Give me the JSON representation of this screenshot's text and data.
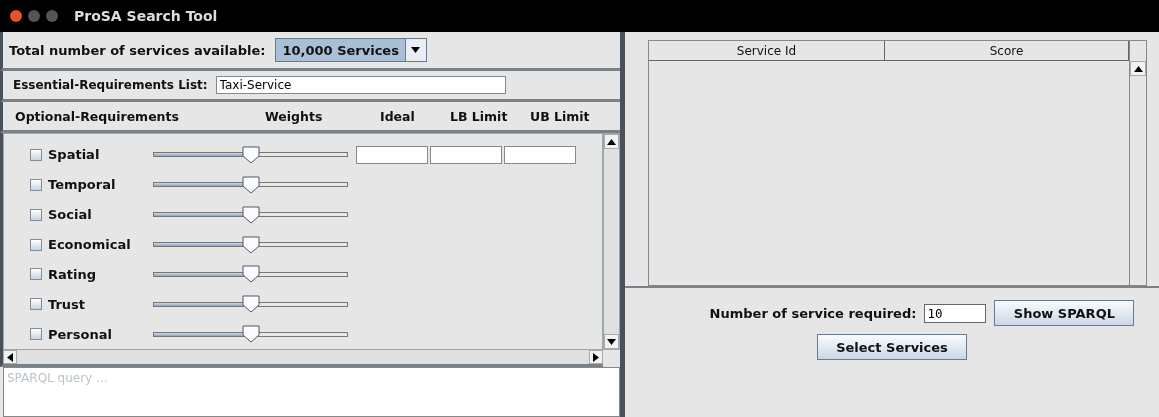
{
  "window": {
    "title": "ProSA Search Tool"
  },
  "services_available": {
    "label": "Total number of services available:",
    "value": "10,000 Services"
  },
  "essential": {
    "label": "Essential-Requirements List:",
    "value": "Taxi-Service"
  },
  "optional_header": {
    "columns": [
      "Optional-Requirements",
      "Weights",
      "Ideal",
      "LB Limit",
      "UB Limit"
    ]
  },
  "requirements": [
    {
      "name": "Spatial",
      "checked": false,
      "level": 0.5,
      "limit_fields": true
    },
    {
      "name": "Temporal",
      "checked": false,
      "level": 0.5,
      "limit_fields": false
    },
    {
      "name": "Social",
      "checked": false,
      "level": 0.5,
      "limit_fields": false
    },
    {
      "name": "Economical",
      "checked": false,
      "level": 0.5,
      "limit_fields": false
    },
    {
      "name": "Rating",
      "checked": false,
      "level": 0.5,
      "limit_fields": false
    },
    {
      "name": "Trust",
      "checked": false,
      "level": 0.5,
      "limit_fields": false
    },
    {
      "name": "Personal",
      "checked": false,
      "level": 0.5,
      "limit_fields": false
    }
  ],
  "sparql": {
    "placeholder": "SPARQL query ..."
  },
  "table": {
    "columns": [
      "Service Id",
      "Score"
    ]
  },
  "required": {
    "label": "Number of service required:",
    "value": "10"
  },
  "buttons": {
    "show_sparql": "Show SPARQL",
    "select": "Select Services"
  }
}
